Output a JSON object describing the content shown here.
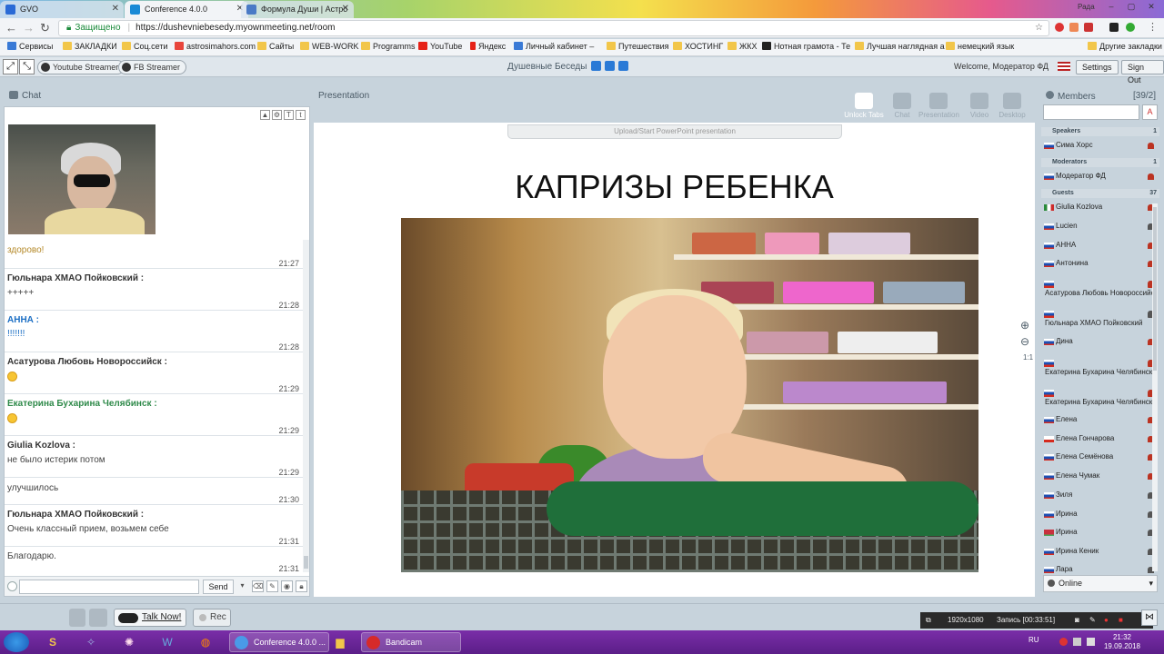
{
  "browser": {
    "tabs": [
      {
        "label": "GVO",
        "favicon_color": "#2a6ad6"
      },
      {
        "label": "Conference 4.0.0",
        "favicon_color": "#1a8ad6"
      },
      {
        "label": "Формула Души | Астро",
        "favicon_color": "#4a7ac6"
      }
    ],
    "user_label": "Рада",
    "secure_label": "Защищено",
    "url": "https://dushevniebesedy.myownmeeting.net/room",
    "bookmarks": [
      {
        "label": "Сервисы",
        "color": "#3a7ad6"
      },
      {
        "label": "ЗАКЛАДКИ",
        "color": "#f2c64a"
      },
      {
        "label": "Соц.сети",
        "color": "#f2c64a"
      },
      {
        "label": "astrosimahors.com",
        "color": "#e8453c"
      },
      {
        "label": "Сайты",
        "color": "#f2c64a"
      },
      {
        "label": "WEB-WORK",
        "color": "#f2c64a"
      },
      {
        "label": "Programms",
        "color": "#f2c64a"
      },
      {
        "label": "YouTube",
        "color": "#e62117"
      },
      {
        "label": "Яндекс",
        "color": "#e62117"
      },
      {
        "label": "Личный кабинет –",
        "color": "#3a7ad6"
      },
      {
        "label": "Путешествия",
        "color": "#f2c64a"
      },
      {
        "label": "ХОСТИНГ",
        "color": "#f2c64a"
      },
      {
        "label": "ЖКХ",
        "color": "#f2c64a"
      },
      {
        "label": "Нотная грамота - Те",
        "color": "#222222"
      },
      {
        "label": "Лучшая наглядная а",
        "color": "#f2c64a"
      },
      {
        "label": "немецкий язык",
        "color": "#f2c64a"
      }
    ],
    "other_bookmarks": "Другие закладки"
  },
  "app": {
    "youtube_streamer": "Youtube Streamer",
    "fb_streamer": "FB Streamer",
    "room_name": "Душевные Беседы",
    "welcome": "Welcome, Модератор ФД",
    "settings": "Settings",
    "sign_out": "Sign Out"
  },
  "chat": {
    "title": "Chat",
    "messages": [
      {
        "author": "",
        "text": "здорово!",
        "time": "21:27",
        "author_color": "#333333",
        "text_color": "#b58a2a"
      },
      {
        "author": "Гюльнара ХМАО Пойковский :",
        "text": "+++++",
        "time": "21:28",
        "author_color": "#333333",
        "text_color": "#444444"
      },
      {
        "author": "АННА :",
        "text": "!!!!!!!",
        "time": "21:28",
        "author_color": "#1c6fc4",
        "text_color": "#1c6fc4"
      },
      {
        "author": "Асатурова Любовь Новороссийск :",
        "text": "",
        "time": "21:29",
        "author_color": "#333333",
        "text_color": "#444444",
        "emoji": "smile"
      },
      {
        "author": "Екатерина Бухарина Челябинск :",
        "text": "",
        "time": "21:29",
        "author_color": "#2f8a4a",
        "text_color": "#444444",
        "emoji": "smile"
      },
      {
        "author": "Giulia Kozlova :",
        "text": "не было истерик потом",
        "time": "21:29",
        "author_color": "#333333",
        "text_color": "#444444"
      },
      {
        "author": "",
        "text": "улучшилось",
        "time": "21:30",
        "author_color": "#333333",
        "text_color": "#444444"
      },
      {
        "author": "Гюльнара ХМАО Пойковский :",
        "text": "Очень классный прием, возьмем себе",
        "time": "21:31",
        "author_color": "#333333",
        "text_color": "#444444"
      },
      {
        "author": "",
        "text": "Благодарю.",
        "time": "21:31",
        "author_color": "#333333",
        "text_color": "#444444"
      }
    ],
    "send_label": "Send"
  },
  "presentation": {
    "title": "Presentation",
    "upload_label": "Upload/Start PowerPoint presentation",
    "slide_title": "КАПРИЗЫ РЕБЕНКА",
    "tabs": [
      {
        "label": "Unlock Tabs",
        "active": true
      },
      {
        "label": "Chat",
        "active": false
      },
      {
        "label": "Presentation",
        "active": false
      },
      {
        "label": "Video",
        "active": false
      },
      {
        "label": "Desktop",
        "active": false
      }
    ],
    "zoom_reset": "1:1"
  },
  "members": {
    "title": "Members",
    "count": "[39/2]",
    "sections": {
      "speakers": {
        "label": "Speakers",
        "count": "1"
      },
      "moderators": {
        "label": "Moderators",
        "count": "1"
      },
      "guests": {
        "label": "Guests",
        "count": "37"
      }
    },
    "speakers": [
      {
        "name": "Сима Хорс",
        "flag": "ru"
      }
    ],
    "moderators": [
      {
        "name": "Модератор ФД",
        "flag": "ru"
      }
    ],
    "guests": [
      {
        "name": "Giulia Kozlova",
        "flag": "it"
      },
      {
        "name": "Lucien",
        "flag": "ru"
      },
      {
        "name": "АННА",
        "flag": "ru"
      },
      {
        "name": "Антонина",
        "flag": "ru"
      },
      {
        "name": "Асатурова Любовь Новороссийск",
        "flag": "ru"
      },
      {
        "name": "Гюльнара ХМАО Пойковский",
        "flag": "ru"
      },
      {
        "name": "Дина",
        "flag": "ru"
      },
      {
        "name": "Екатерина Бухарина Челябинск",
        "flag": "ru"
      },
      {
        "name": "Екатерина Бухарина Челябинск",
        "flag": "ru"
      },
      {
        "name": "Елена",
        "flag": "ru"
      },
      {
        "name": "Елена Гончарова",
        "flag": "cz"
      },
      {
        "name": "Елена Семёнова",
        "flag": "ru"
      },
      {
        "name": "Елена Чумак",
        "flag": "ru"
      },
      {
        "name": "Зиля",
        "flag": "ru"
      },
      {
        "name": "Ирина",
        "flag": "ru"
      },
      {
        "name": "Ирина",
        "flag": "by"
      },
      {
        "name": "Ирина Кеник",
        "flag": "ru"
      },
      {
        "name": "Лара",
        "flag": "ru"
      }
    ],
    "status": "Online"
  },
  "bottom": {
    "talk_now": "Talk Now!",
    "rec": "Rec",
    "resolution": "1920x1080",
    "recording": "Запись [00:33:51]"
  },
  "taskbar": {
    "items": [
      {
        "label": "Conference 4.0.0 ...",
        "color": "#4a9ae8"
      },
      {
        "label": "Bandicam",
        "color": "#d62a2a"
      }
    ],
    "lang": "RU",
    "time": "21:32",
    "date": "19.09.2018"
  }
}
